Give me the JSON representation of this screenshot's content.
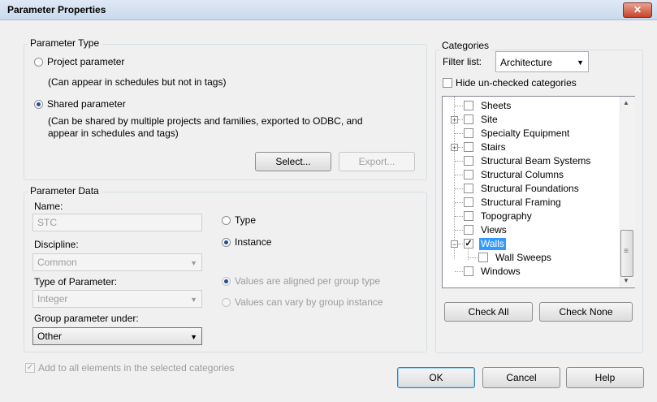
{
  "window": {
    "title": "Parameter Properties",
    "close_glyph": "✕"
  },
  "parameter_type": {
    "group_label": "Parameter Type",
    "project_label": "Project parameter",
    "project_note": "(Can appear in schedules but not in tags)",
    "shared_label": "Shared parameter",
    "shared_note_1": "(Can be shared by multiple projects and families, exported to ODBC, and",
    "shared_note_2": "appear in schedules and tags)",
    "selected": "shared",
    "select_button": "Select...",
    "export_button": "Export..."
  },
  "parameter_data": {
    "group_label": "Parameter Data",
    "name_label": "Name:",
    "name_value": "STC",
    "discipline_label": "Discipline:",
    "discipline_value": "Common",
    "type_param_label": "Type of Parameter:",
    "type_param_value": "Integer",
    "group_under_label": "Group parameter under:",
    "group_under_value": "Other",
    "type_radio": "Type",
    "instance_radio": "Instance",
    "selected": "instance",
    "aligned_label": "Values are aligned per group type",
    "vary_label": "Values can vary by group instance"
  },
  "categories": {
    "group_label": "Categories",
    "filter_label": "Filter list:",
    "filter_value": "Architecture",
    "hide_label": "Hide un-checked categories",
    "items": [
      {
        "label": "Sheets",
        "checked": false,
        "expandable": false
      },
      {
        "label": "Site",
        "checked": false,
        "expandable": true,
        "expand_glyph": "+"
      },
      {
        "label": "Specialty Equipment",
        "checked": false,
        "expandable": false
      },
      {
        "label": "Stairs",
        "checked": false,
        "expandable": true,
        "expand_glyph": "+"
      },
      {
        "label": "Structural Beam Systems",
        "checked": false,
        "expandable": false
      },
      {
        "label": "Structural Columns",
        "checked": false,
        "expandable": false
      },
      {
        "label": "Structural Foundations",
        "checked": false,
        "expandable": false
      },
      {
        "label": "Structural Framing",
        "checked": false,
        "expandable": false
      },
      {
        "label": "Topography",
        "checked": false,
        "expandable": false
      },
      {
        "label": "Views",
        "checked": false,
        "expandable": false
      },
      {
        "label": "Walls",
        "checked": true,
        "expandable": true,
        "expand_glyph": "−",
        "selected": true
      },
      {
        "label": "Wall Sweeps",
        "checked": false,
        "expandable": false,
        "child": true
      },
      {
        "label": "Windows",
        "checked": false,
        "expandable": false
      }
    ],
    "check_all": "Check All",
    "check_none": "Check None"
  },
  "footer": {
    "add_all_label": "Add to all elements in the selected categories",
    "ok": "OK",
    "cancel": "Cancel",
    "help": "Help"
  },
  "glyphs": {
    "dropdown": "▼",
    "check": "✓",
    "scroll_up": "▲",
    "scroll_down": "▼",
    "grip": "≡"
  },
  "colors": {
    "selection": "#3399ff",
    "accent_radio": "#1d4f9a",
    "title_gradient_top": "#dfe9f5"
  }
}
